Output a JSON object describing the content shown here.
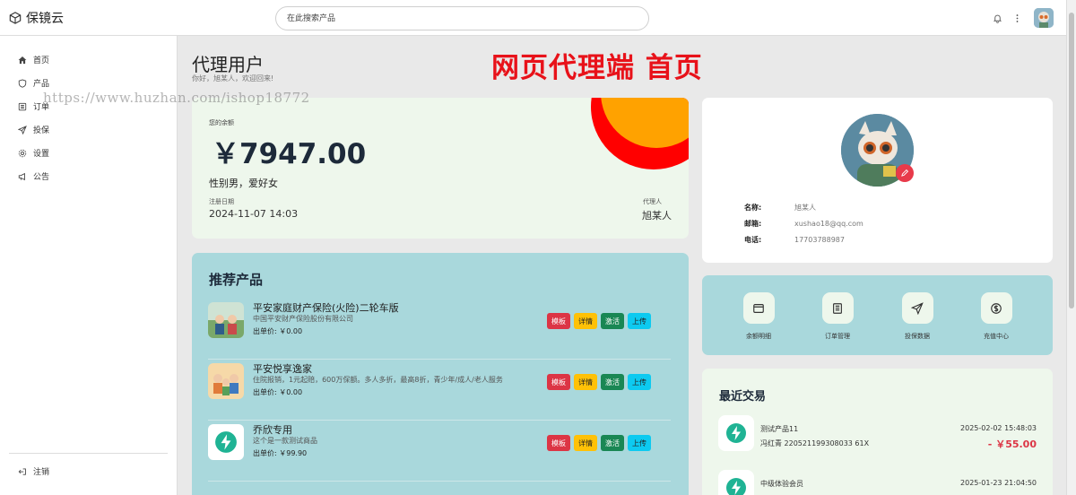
{
  "app": {
    "name": "保镜云"
  },
  "search": {
    "placeholder": "在此搜索产品"
  },
  "sidebar": {
    "items": [
      {
        "label": "首页",
        "icon": "home-icon"
      },
      {
        "label": "产品",
        "icon": "shield-icon"
      },
      {
        "label": "订单",
        "icon": "list-icon"
      },
      {
        "label": "投保",
        "icon": "send-icon"
      },
      {
        "label": "设置",
        "icon": "gear-icon"
      },
      {
        "label": "公告",
        "icon": "megaphone-icon"
      }
    ],
    "logout": "注销"
  },
  "header": {
    "title": "代理用户",
    "subtitle": "你好，旭某人，欢迎回来!",
    "banner": "网页代理端 首页",
    "watermark": "https://www.huzhan.com/ishop18772"
  },
  "balance": {
    "label": "您的余额",
    "amount": "￥7947.00",
    "bio": "性别男，爱好女",
    "reg_label": "注册日期",
    "reg_date": "2024-11-07 14:03",
    "agent_label": "代理人",
    "agent_name": "旭某人"
  },
  "profile": {
    "name_label": "名称:",
    "name": "旭某人",
    "email_label": "邮箱:",
    "email": "xushao18@qq.com",
    "phone_label": "电话:",
    "phone": "17703788987"
  },
  "quick_actions": [
    {
      "label": "余额明细",
      "icon": "wallet-icon"
    },
    {
      "label": "订单管理",
      "icon": "receipt-icon"
    },
    {
      "label": "投保数据",
      "icon": "send-icon"
    },
    {
      "label": "充值中心",
      "icon": "dollar-icon"
    }
  ],
  "products": {
    "title": "推荐产品",
    "buttons": {
      "template": "模板",
      "detail": "详情",
      "activate": "激活",
      "upload": "上传"
    },
    "items": [
      {
        "name": "平安家庭财产保险(火险)二轮车版",
        "desc": "中国平安财产保险股份有限公司",
        "price": "出单价: ￥0.00"
      },
      {
        "name": "平安悦享逸家",
        "desc": "住院报销，1元起赔，600万保额。多人多折，最高8折，青少年/成人/老人服务",
        "price": "出单价: ￥0.00"
      },
      {
        "name": "乔欣专用",
        "desc": "这个是一款测试商品",
        "price": "出单价: ￥99.90"
      }
    ]
  },
  "recent": {
    "title": "最近交易",
    "items": [
      {
        "title": "测试产品11",
        "sub": "冯红青 220521199308033 61X",
        "date": "2025-02-02 15:48:03",
        "amount": "- ￥55.00"
      },
      {
        "title": "中级体验会员",
        "sub": "",
        "date": "2025-01-23 21:04:50",
        "amount": ""
      }
    ]
  },
  "colors": {
    "accent_red": "#dc3545",
    "banner_red": "#e8121a",
    "teal_panel": "#a9d8dc",
    "mint_panel": "#eef7ec"
  }
}
